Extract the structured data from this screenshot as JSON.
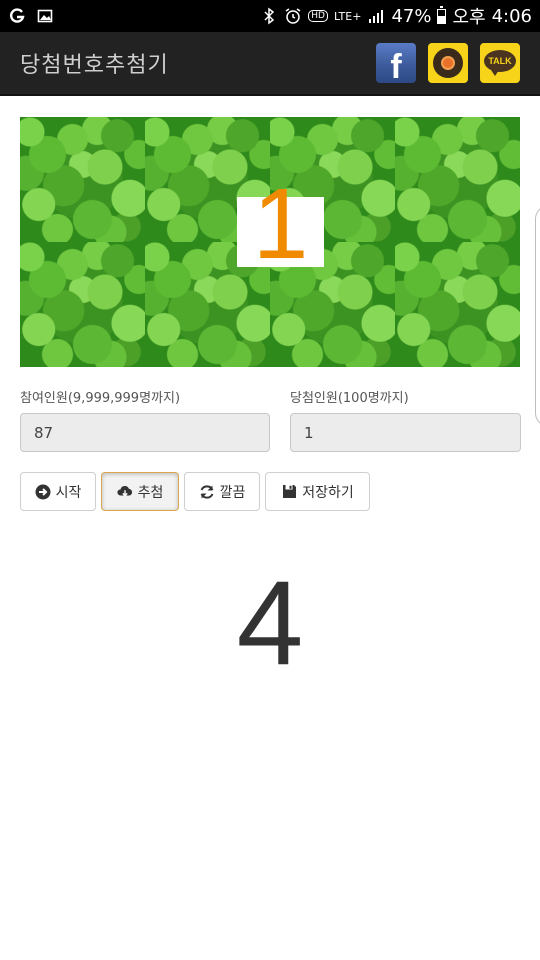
{
  "status_bar": {
    "battery": "47%",
    "network": "LTE+",
    "time_prefix": "오후",
    "time": "4:06",
    "icons": [
      "g-icon",
      "image-icon",
      "bluetooth-icon",
      "alarm-icon",
      "hd-icon",
      "lte-icon",
      "signal-icon",
      "battery-icon"
    ]
  },
  "app_bar": {
    "title": "당첨번호추첨기",
    "share": [
      {
        "name": "facebook-icon",
        "label": "f"
      },
      {
        "name": "kakaostory-icon",
        "label": ""
      },
      {
        "name": "kakaotalk-icon",
        "label": "TALK"
      }
    ]
  },
  "draw_panel": {
    "current_digit": "1",
    "digit_color": "#f08a00"
  },
  "form": {
    "participants_label": "참여인원(9,999,999명까지)",
    "participants_value": "87",
    "winners_label": "당첨인원(100명까지)",
    "winners_value": "1"
  },
  "buttons": {
    "start": "시작",
    "draw": "추첨",
    "clear": "깔끔",
    "save": "저장하기"
  },
  "result": {
    "number": "4"
  }
}
